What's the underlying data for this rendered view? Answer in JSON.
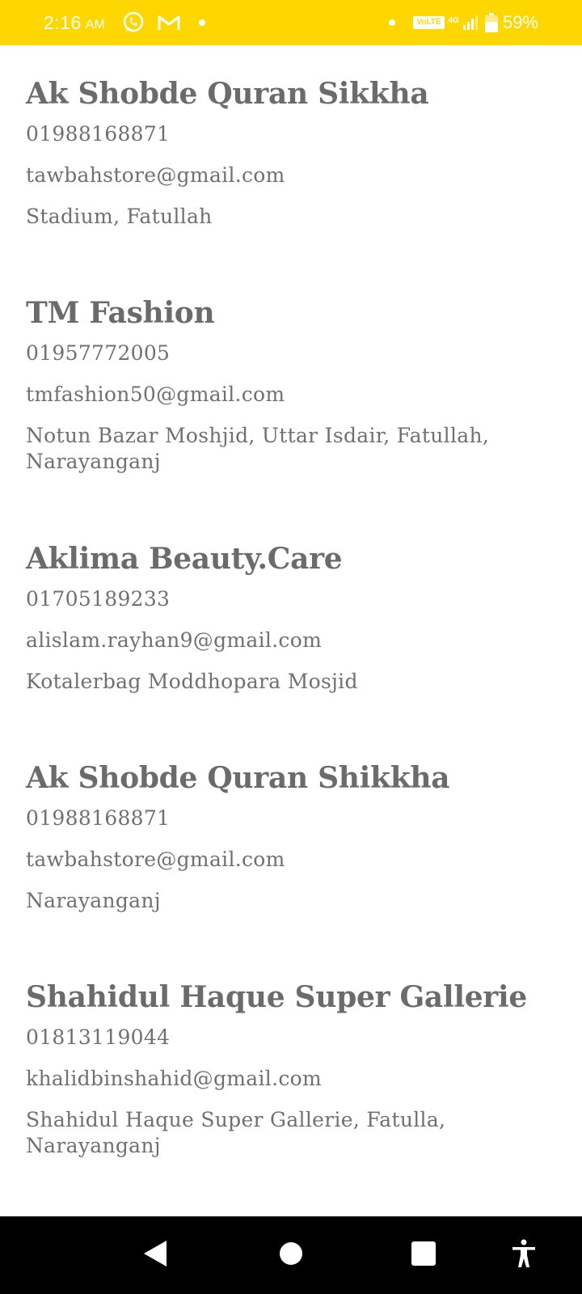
{
  "status_bar": {
    "time": "2:16",
    "ampm": "AM",
    "network_badge": "VoLTE",
    "network_type": "4G",
    "battery_percent": "59%",
    "accent_color": "#FFD700"
  },
  "entries": [
    {
      "name": "Ak Shobde Quran Sikkha",
      "phone": "01988168871",
      "email": "tawbahstore@gmail.com",
      "address": "Stadium, Fatullah"
    },
    {
      "name": "TM Fashion",
      "phone": "01957772005",
      "email": "tmfashion50@gmail.com",
      "address": "Notun Bazar Moshjid, Uttar Isdair, Fatullah, Narayanganj"
    },
    {
      "name": "Aklima Beauty.Care",
      "phone": "01705189233",
      "email": "alislam.rayhan9@gmail.com",
      "address": "Kotalerbag Moddhopara Mosjid"
    },
    {
      "name": "Ak Shobde Quran Shikkha",
      "phone": "01988168871",
      "email": "tawbahstore@gmail.com",
      "address": "Narayanganj"
    },
    {
      "name": "Shahidul Haque Super Gallerie",
      "phone": "01813119044",
      "email": "khalidbinshahid@gmail.com",
      "address": "Shahidul Haque Super Gallerie,  Fatulla, Narayanganj"
    }
  ],
  "nav_bar": {
    "icons": [
      "back-icon",
      "home-icon",
      "recents-icon",
      "accessibility-icon"
    ]
  }
}
